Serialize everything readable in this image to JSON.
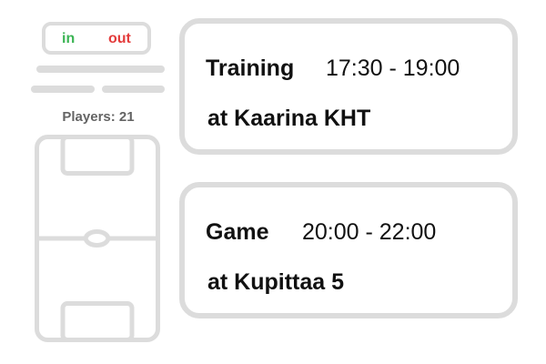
{
  "attendance_toggle": {
    "in_label": "in",
    "out_label": "out",
    "in_color": "#3bb454",
    "out_color": "#e33b3b"
  },
  "players": {
    "label": "Players: 21"
  },
  "events": [
    {
      "title": "Training",
      "time": "17:30 - 19:00",
      "location": "at Kaarina KHT"
    },
    {
      "title": "Game",
      "time": "20:00 - 22:00",
      "location": "at Kupittaa 5"
    }
  ],
  "icons": {
    "pitch": "football-pitch-icon"
  },
  "colors": {
    "outline": "#dcdcdc",
    "text": "#111111",
    "muted_text": "#646464"
  }
}
